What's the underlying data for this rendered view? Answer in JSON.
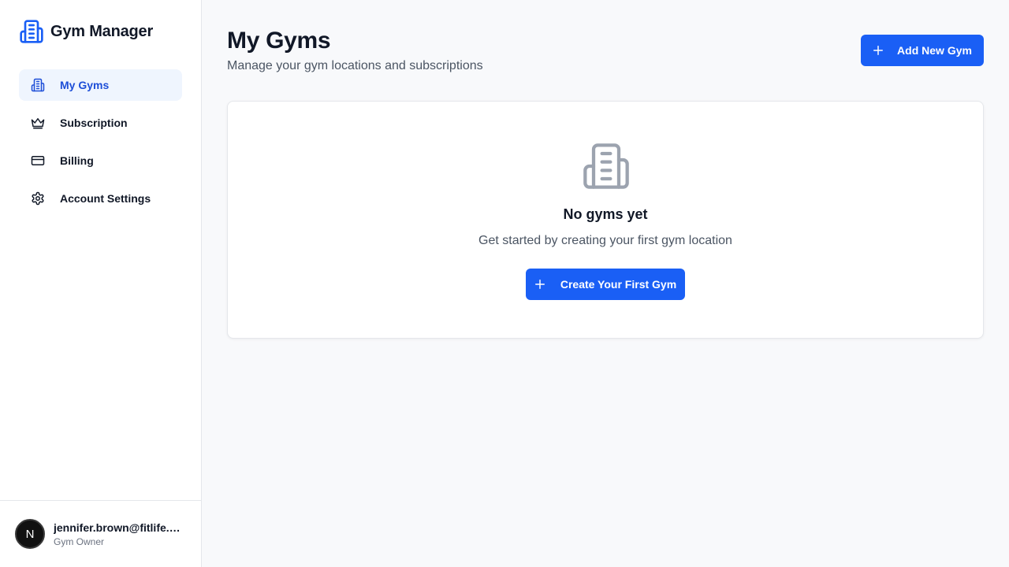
{
  "app": {
    "name": "Gym Manager",
    "logo_icon": "building-icon",
    "accent_color": "#1a5ff5"
  },
  "sidebar": {
    "items": [
      {
        "label": "My Gyms",
        "icon": "building-icon",
        "active": true
      },
      {
        "label": "Subscription",
        "icon": "crown-icon",
        "active": false
      },
      {
        "label": "Billing",
        "icon": "credit-card-icon",
        "active": false
      },
      {
        "label": "Account Settings",
        "icon": "gear-icon",
        "active": false
      }
    ]
  },
  "user": {
    "avatar_initial": "N",
    "email": "jennifer.brown@fitlife.com",
    "role": "Gym Owner"
  },
  "header": {
    "title": "My Gyms",
    "subtitle": "Manage your gym locations and subscriptions",
    "add_button_label": "Add New Gym"
  },
  "empty_state": {
    "icon": "building-icon",
    "title": "No gyms yet",
    "description": "Get started by creating your first gym location",
    "button_label": "Create Your First Gym"
  }
}
